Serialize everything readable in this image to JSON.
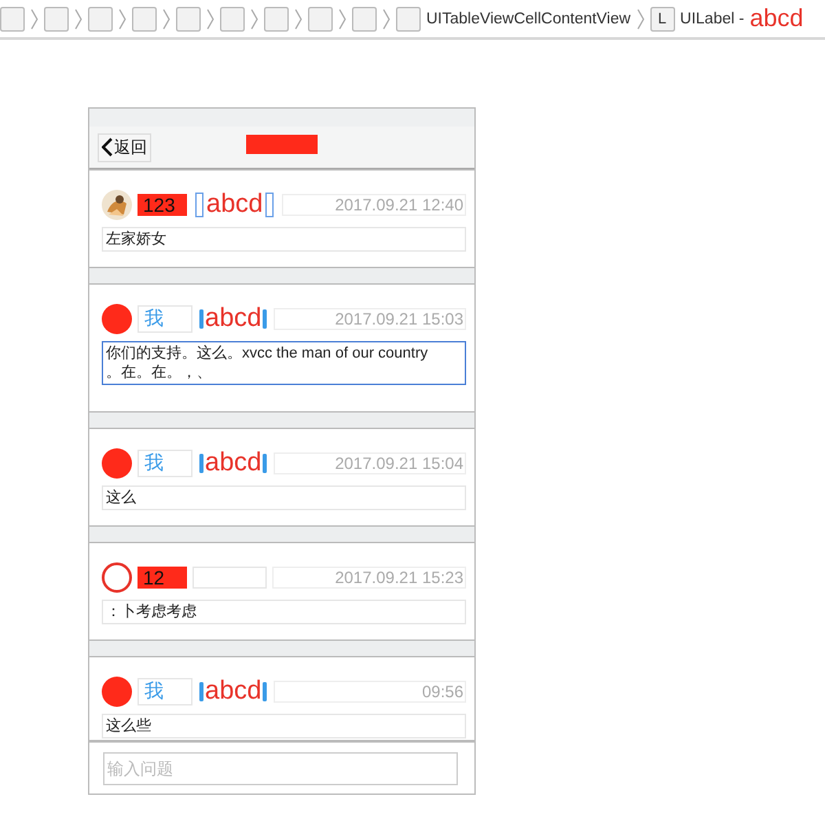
{
  "breadcrumb": {
    "path_items": [
      "UITableViewCellContentView",
      "UILabel -"
    ],
    "label_icon": "L",
    "selection": "abcd"
  },
  "nav_bar": {
    "back": "返回",
    "title_redacted": true
  },
  "cells": [
    {
      "name": "123",
      "name_highlighted": true,
      "tag": {
        "kind": "bracket",
        "text": "abcd"
      },
      "time": "2017.09.21 12:40",
      "message": "左家娇女",
      "selected": false
    },
    {
      "avatar": {
        "kind": "filled"
      },
      "name": "我",
      "name_highlighted": false,
      "tag": {
        "kind": "bar",
        "text": "abcd"
      },
      "time": "2017.09.21 15:03",
      "message": "你们的支持。这么。xvcc the man of our country 。在。在。，、",
      "selected": true
    },
    {
      "avatar": {
        "kind": "filled"
      },
      "name": "我",
      "name_highlighted": false,
      "tag": {
        "kind": "bar",
        "text": "abcd"
      },
      "time": "2017.09.21 15:04",
      "message": "这么",
      "selected": false
    },
    {
      "avatar": {
        "kind": "outline"
      },
      "name": "12",
      "name_highlighted": true,
      "tag": {
        "kind": "empty"
      },
      "time": "2017.09.21 15:23",
      "message": "：卜考虑考虑",
      "selected": false
    },
    {
      "avatar": {
        "kind": "filled"
      },
      "name": "我",
      "name_highlighted": false,
      "tag": {
        "kind": "bar",
        "text": "abcd"
      },
      "time": "09:56",
      "message": "这么些",
      "selected": false
    }
  ],
  "input": {
    "placeholder": "输入问题"
  }
}
